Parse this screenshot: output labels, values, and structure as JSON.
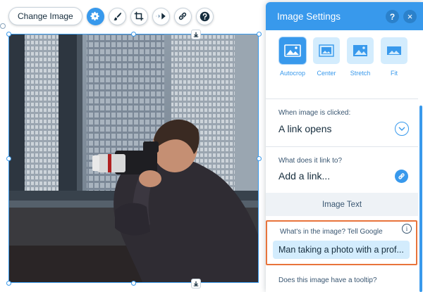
{
  "toolbar": {
    "change_image_label": "Change Image",
    "buttons": [
      {
        "icon": "gear-icon",
        "active": true
      },
      {
        "icon": "brush-icon",
        "active": false
      },
      {
        "icon": "crop-icon",
        "active": false
      },
      {
        "icon": "animation-icon",
        "active": false
      },
      {
        "icon": "link-icon",
        "active": false
      },
      {
        "icon": "help-icon",
        "active": false
      }
    ]
  },
  "panel": {
    "title": "Image Settings",
    "help_label": "?",
    "close_label": "×",
    "fit_options": [
      {
        "label": "Autocrop",
        "selected": true
      },
      {
        "label": "Center",
        "selected": false
      },
      {
        "label": "Stretch",
        "selected": false
      },
      {
        "label": "Fit",
        "selected": false
      }
    ],
    "click_action": {
      "label": "When image is clicked:",
      "value": "A link opens"
    },
    "link_target": {
      "label": "What does it link to?",
      "value": "Add a link..."
    },
    "image_text": {
      "heading": "Image Text",
      "alt_label": "What's in the image? Tell Google",
      "alt_value": "Man taking a photo with a prof...",
      "info_label": "i",
      "tooltip_label": "Does this image have a tooltip?"
    }
  },
  "colors": {
    "accent": "#3899ec",
    "highlight": "#e8743b",
    "panel_text": "#162d3d"
  }
}
